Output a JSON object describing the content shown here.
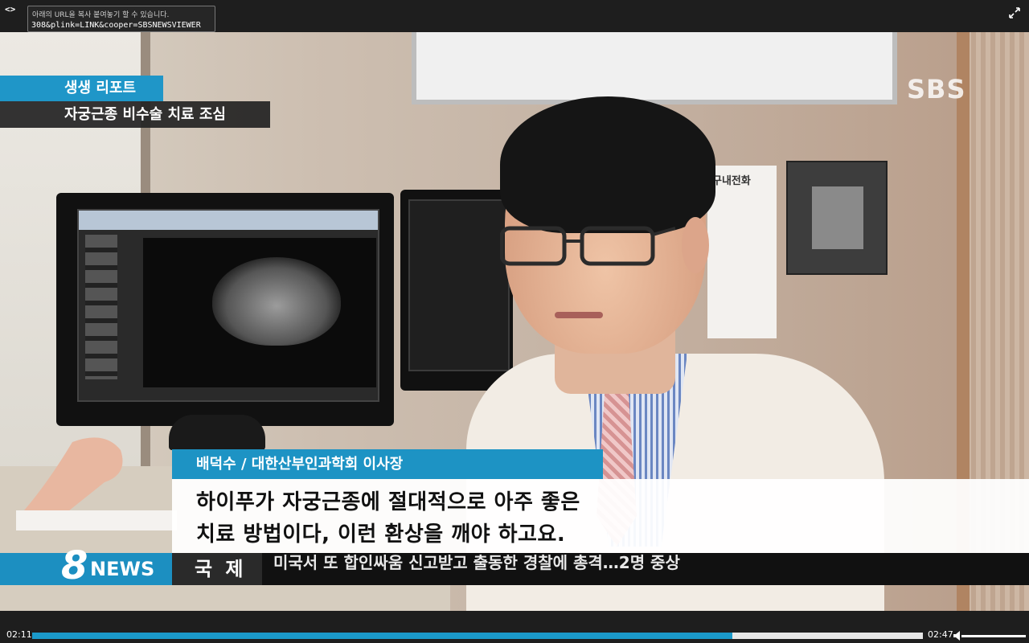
{
  "player": {
    "embed_icon": "<>",
    "url_hint": "아래의 URL을 복사 붙여놓기 할 수 있습니다.",
    "url_value": "308&plink=LINK&cooper=SBSNEWSVIEWER",
    "fullscreen_icon": "fullscreen-icon"
  },
  "broadcast": {
    "logo": "SBS",
    "segment_tag": "생생 리포트",
    "segment_title": "자궁근종 비수술 치료 조심",
    "sign_text": "구내전화"
  },
  "lower_third": {
    "speaker": "배덕수 / 대한산부인과학회 이사장",
    "caption_line1": "하이푸가 자궁근종에 절대적으로 아주 좋은",
    "caption_line2": "치료 방법이다, 이런 환상을 깨야 하고요."
  },
  "ticker": {
    "logo_number": "8",
    "logo_text": "NEWS",
    "category": "국 제",
    "headline": "미국서 또 합인싸움 신고받고 출동한 경찰에 총격…2명 중상"
  },
  "controls": {
    "current_time": "02:11",
    "duration": "02:47",
    "progress_percent": 78.6,
    "volume_level": 1.0
  },
  "colors": {
    "accent_blue": "#1d93c4",
    "caption_bg": "#ffffff",
    "bar_bg": "#1e1e1e"
  }
}
